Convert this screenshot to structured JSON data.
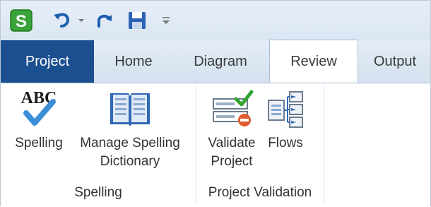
{
  "quick_access": {
    "app_icon_letter": "S",
    "items": [
      "app-logo",
      "undo",
      "undo-dropdown",
      "redo",
      "save",
      "customize-toolbar"
    ]
  },
  "tabs": [
    {
      "label": "Project"
    },
    {
      "label": "Home"
    },
    {
      "label": "Diagram"
    },
    {
      "label": "Review"
    },
    {
      "label": "Output"
    }
  ],
  "active_tab": "Review",
  "ribbon": {
    "groups": [
      {
        "label": "Spelling",
        "buttons": [
          {
            "line1": "Spelling",
            "line2": "",
            "icon": "abc-check-icon"
          },
          {
            "line1": "Manage Spelling",
            "line2": "Dictionary",
            "icon": "book-icon"
          }
        ]
      },
      {
        "label": "Project Validation",
        "buttons": [
          {
            "line1": "Validate",
            "line2": "Project",
            "icon": "validate-icon"
          },
          {
            "line1": "Flows",
            "line2": "",
            "icon": "flows-icon"
          }
        ]
      }
    ]
  },
  "abc_text": "ABC",
  "colors": {
    "project_tab": "#1c4f8f",
    "logo": "#3aa23a",
    "undo": "#1d5fae",
    "check": "#3c8fd6"
  }
}
